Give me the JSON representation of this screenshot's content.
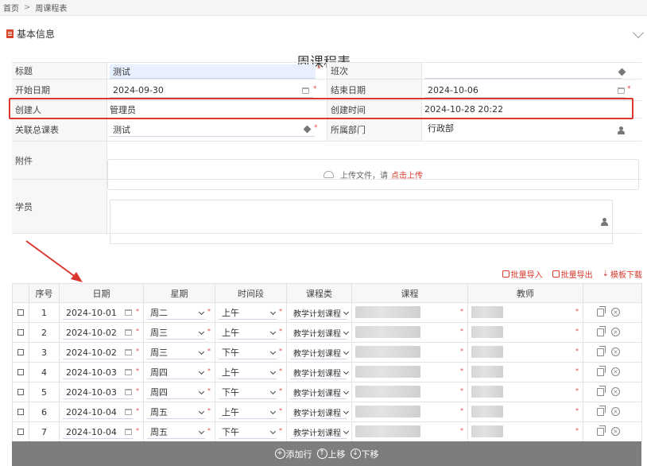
{
  "breadcrumb": {
    "home": "首页",
    "sep": ">",
    "current": "周课程表"
  },
  "section": {
    "title": "基本信息"
  },
  "page_title": "周课程表",
  "form": {
    "title_label": "标题",
    "title_value": "测试",
    "class_label": "班次",
    "class_value": "",
    "start_label": "开始日期",
    "start_value": "2024-09-30",
    "end_label": "结束日期",
    "end_value": "2024-10-06",
    "creator_label": "创建人",
    "creator_value": "管理员",
    "created_label": "创建时间",
    "created_value": "2024-10-28 20:22",
    "master_label": "关联总课表",
    "master_value": "测试",
    "dept_label": "所属部门",
    "dept_value": "行政部",
    "attach_label": "附件",
    "upload_text": "上传文件，请",
    "upload_link": "点击上传",
    "student_label": "学员"
  },
  "actions": {
    "import": "批量导入",
    "export": "批量导出",
    "template": "模板下载"
  },
  "table": {
    "headers": [
      "序号",
      "日期",
      "星期",
      "时间段",
      "课程类",
      "课程",
      "教师"
    ],
    "rows": [
      {
        "no": "1",
        "date": "2024-10-01",
        "weekday": "周二",
        "period": "上午",
        "type": "教学计划课程"
      },
      {
        "no": "2",
        "date": "2024-10-02",
        "weekday": "周三",
        "period": "上午",
        "type": "教学计划课程"
      },
      {
        "no": "3",
        "date": "2024-10-02",
        "weekday": "周三",
        "period": "下午",
        "type": "教学计划课程"
      },
      {
        "no": "4",
        "date": "2024-10-03",
        "weekday": "周四",
        "period": "上午",
        "type": "教学计划课程"
      },
      {
        "no": "5",
        "date": "2024-10-03",
        "weekday": "周四",
        "period": "下午",
        "type": "教学计划课程"
      },
      {
        "no": "6",
        "date": "2024-10-04",
        "weekday": "周五",
        "period": "上午",
        "type": "教学计划课程"
      },
      {
        "no": "7",
        "date": "2024-10-04",
        "weekday": "周五",
        "period": "下午",
        "type": "教学计划课程"
      }
    ]
  },
  "bottom": {
    "add_row": "添加行",
    "move_up": "上移",
    "move_down": "下移"
  },
  "colors": {
    "accent_red": "#d9382e",
    "bar_gray": "#7d7d7d"
  }
}
